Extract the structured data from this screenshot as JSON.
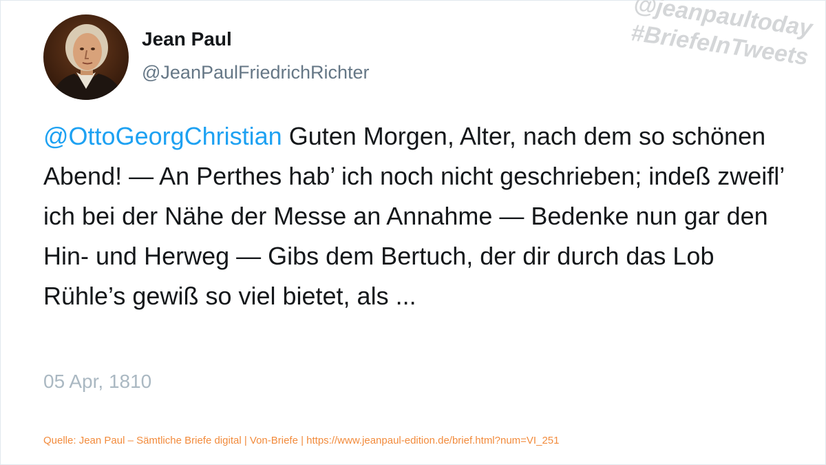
{
  "author": {
    "name": "Jean Paul",
    "handle": "@JeanPaulFriedrichRichter",
    "avatar": "portrait-avatar"
  },
  "watermark": {
    "line1": "@jeanpaultoday",
    "line2": "#BriefeInTweets"
  },
  "tweet": {
    "mention": "@OttoGeorgChristian",
    "text": " Guten Morgen, Alter, nach dem so schönen Abend! — An Perthes hab’ ich noch nicht geschrieben; indeß zweifl’ ich bei der Nähe der Messe an Annahme — Bedenke nun gar den Hin- und Herweg — Gibs dem Bertuch, der dir durch das Lob Rühle’s gewiß so viel bietet, als ...",
    "date": "05 Apr, 1810"
  },
  "source": "Quelle: Jean Paul – Sämtliche Briefe digital | Von-Briefe | https://www.jeanpaul-edition.de/brief.html?num=VI_251",
  "colors": {
    "mention": "#1da1f2",
    "source": "#f28b3c",
    "date": "#aab8c2",
    "handle": "#657786"
  }
}
